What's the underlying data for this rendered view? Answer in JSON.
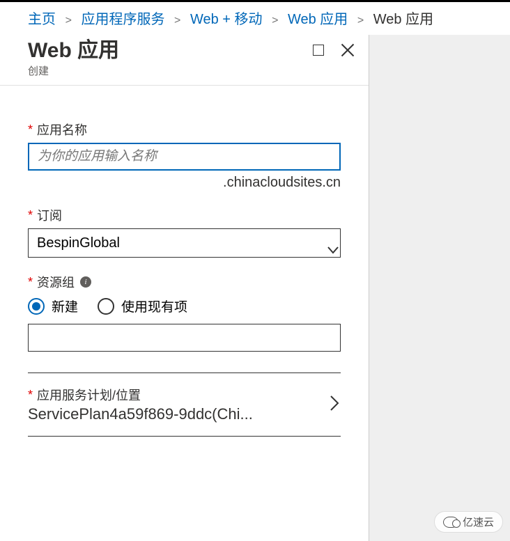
{
  "breadcrumb": {
    "items": [
      {
        "label": "主页",
        "link": true
      },
      {
        "label": "应用程序服务",
        "link": true
      },
      {
        "label": "Web + 移动",
        "link": true
      },
      {
        "label": "Web 应用",
        "link": true
      },
      {
        "label": "Web 应用",
        "link": false
      }
    ]
  },
  "blade": {
    "title": "Web 应用",
    "subtitle": "创建"
  },
  "form": {
    "app_name": {
      "label": "应用名称",
      "placeholder": "为你的应用输入名称",
      "value": "",
      "suffix": ".chinacloudsites.cn"
    },
    "subscription": {
      "label": "订阅",
      "value": "BespinGlobal"
    },
    "resource_group": {
      "label": "资源组",
      "options": {
        "new": "新建",
        "existing": "使用现有项"
      },
      "selected": "new",
      "input_value": ""
    },
    "service_plan": {
      "label": "应用服务计划/位置",
      "value": "ServicePlan4a59f869-9ddc(Chi..."
    }
  },
  "watermark": {
    "text": "亿速云"
  }
}
